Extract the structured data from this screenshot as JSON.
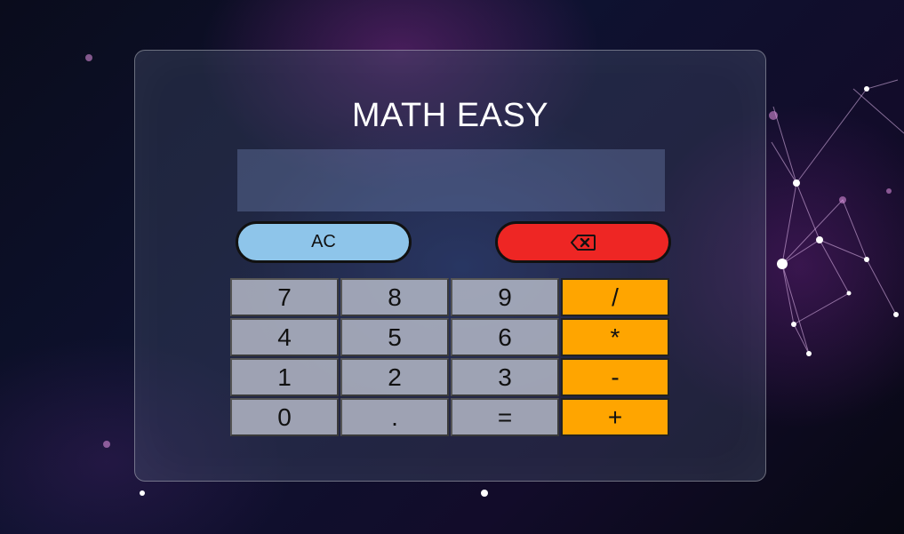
{
  "app": {
    "title": "MATH EASY"
  },
  "display": {
    "value": ""
  },
  "controls": {
    "clear_label": "AC",
    "delete_icon": "backspace-icon"
  },
  "keypad": {
    "rows": [
      [
        "7",
        "8",
        "9",
        "/"
      ],
      [
        "4",
        "5",
        "6",
        "*"
      ],
      [
        "1",
        "2",
        "3",
        "-"
      ],
      [
        "0",
        ".",
        "=",
        "+"
      ]
    ]
  },
  "colors": {
    "clear_button": "#8ec5ea",
    "delete_button": "#ee2624",
    "operator_key": "#ffa500",
    "number_key": "#afb4c3",
    "title": "#ffffff"
  }
}
